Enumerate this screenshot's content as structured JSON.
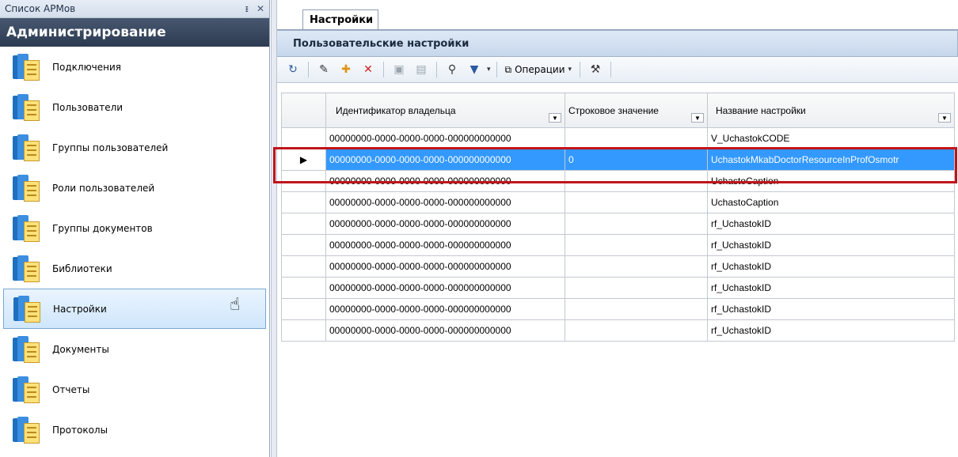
{
  "left_panel": {
    "header_title": "Список АРМов",
    "pin_glyph": "ᵻ",
    "close_glyph": "✕",
    "section_title": "Администрирование",
    "items": [
      {
        "label": "Подключения",
        "icon": "book-icon"
      },
      {
        "label": "Пользователи",
        "icon": "book-icon"
      },
      {
        "label": "Группы пользователей",
        "icon": "book-icon"
      },
      {
        "label": "Роли пользователей",
        "icon": "book-icon"
      },
      {
        "label": "Группы документов",
        "icon": "book-icon"
      },
      {
        "label": "Библиотеки",
        "icon": "book-icon"
      },
      {
        "label": "Настройки",
        "icon": "book-icon",
        "selected": true
      },
      {
        "label": "Документы",
        "icon": "book-icon"
      },
      {
        "label": "Отчеты",
        "icon": "book-icon"
      },
      {
        "label": "Протоколы",
        "icon": "book-icon"
      }
    ]
  },
  "tab": {
    "label": "Настройки"
  },
  "panel": {
    "title": "Пользовательские настройки"
  },
  "toolbar": {
    "operations_label": "Операции",
    "icons": [
      "refresh-icon",
      "edit-icon",
      "add-icon",
      "delete-icon",
      "save-icon",
      "save-all-icon",
      "find-icon",
      "filter-icon",
      "operations-icon",
      "tools-icon"
    ]
  },
  "grid": {
    "columns": [
      "Идентификатор владельца",
      "Строковое значение",
      "Название настройки"
    ],
    "rows": [
      {
        "owner": "00000000-0000-0000-0000-000000000000",
        "value": "",
        "name": "V_UchastokCODE"
      },
      {
        "owner": "00000000-0000-0000-0000-000000000000",
        "value": "0",
        "name": "UchastokMkabDoctorResourceInProfOsmotr",
        "selected": true
      },
      {
        "owner": "00000000-0000-0000-0000-000000000000",
        "value": "",
        "name": "UchastoCaption"
      },
      {
        "owner": "00000000-0000-0000-0000-000000000000",
        "value": "",
        "name": "UchastoCaption"
      },
      {
        "owner": "00000000-0000-0000-0000-000000000000",
        "value": "",
        "name": "rf_UchastokID"
      },
      {
        "owner": "00000000-0000-0000-0000-000000000000",
        "value": "",
        "name": "rf_UchastokID"
      },
      {
        "owner": "00000000-0000-0000-0000-000000000000",
        "value": "",
        "name": "rf_UchastokID"
      },
      {
        "owner": "00000000-0000-0000-0000-000000000000",
        "value": "",
        "name": "rf_UchastokID"
      },
      {
        "owner": "00000000-0000-0000-0000-000000000000",
        "value": "",
        "name": "rf_UchastokID"
      },
      {
        "owner": "00000000-0000-0000-0000-000000000000",
        "value": "",
        "name": "rf_UchastokID"
      }
    ]
  },
  "colors": {
    "selection": "#3399ff",
    "highlight_border": "#c0141a",
    "section_bg": "#2c3b52"
  }
}
